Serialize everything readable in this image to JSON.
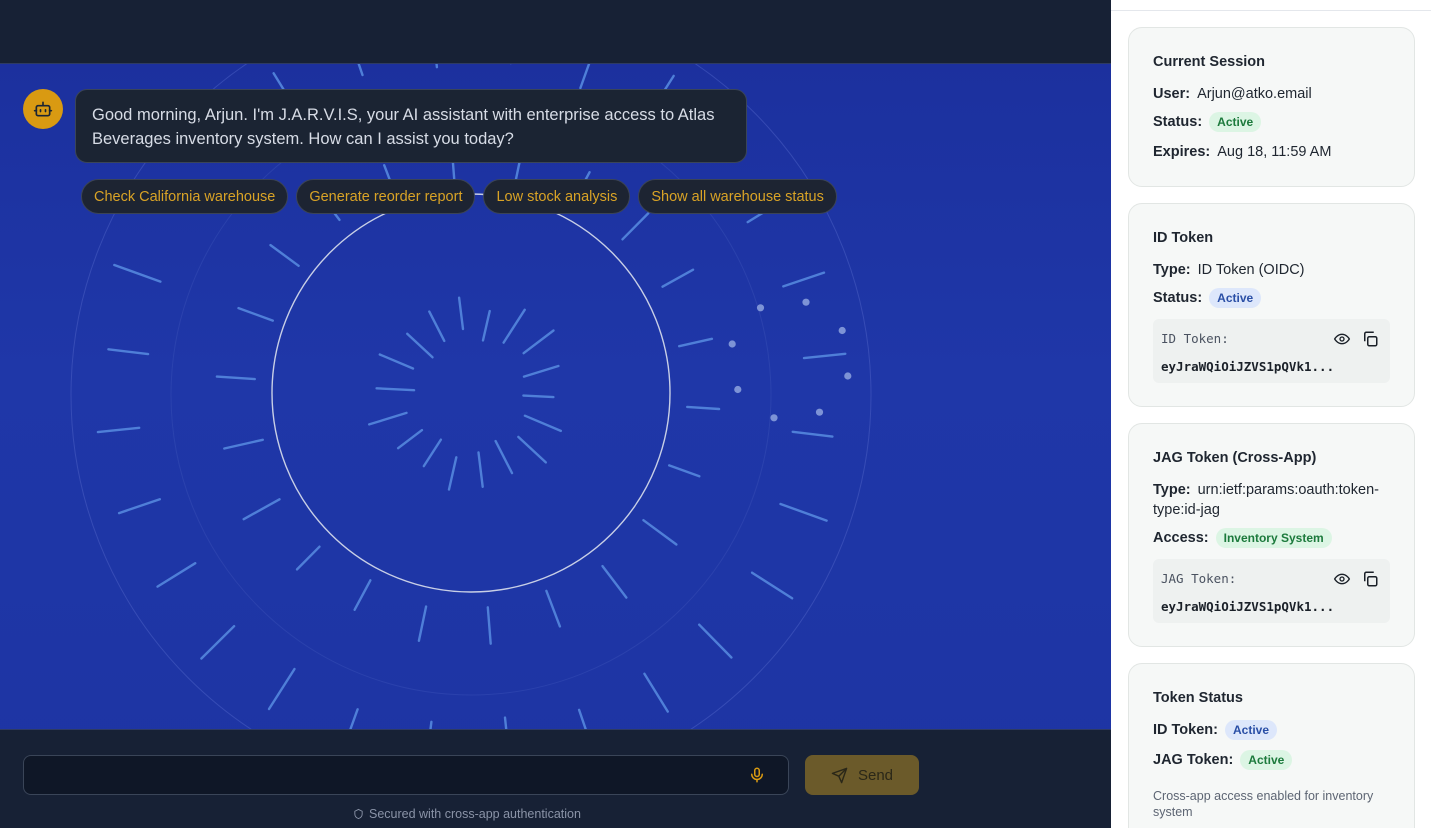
{
  "chat": {
    "assistant_message": "Good morning, Arjun. I'm J.A.R.V.I.S, your AI assistant with enterprise access to Atlas Beverages inventory system. How can I assist you today?",
    "suggestions": [
      "Check California warehouse",
      "Generate reorder report",
      "Low stock analysis",
      "Show all warehouse status"
    ],
    "input_value": "",
    "send_label": "Send",
    "security_note": "Secured with cross-app authentication"
  },
  "panel": {
    "session": {
      "title": "Current Session",
      "user_label": "User:",
      "user_value": "Arjun@atko.email",
      "status_label": "Status:",
      "status_value": "Active",
      "expires_label": "Expires:",
      "expires_value": "Aug 18, 11:59 AM"
    },
    "id_token": {
      "title": "ID Token",
      "type_label": "Type:",
      "type_value": "ID Token (OIDC)",
      "status_label": "Status:",
      "status_value": "Active",
      "box_label": "ID Token:",
      "box_value": "eyJraWQiOiJZVS1pQVk1..."
    },
    "jag_token": {
      "title": "JAG Token (Cross-App)",
      "type_label": "Type:",
      "type_value_line1": "urn:ietf:params:oauth:token-",
      "type_value_line2": "type:id-jag",
      "access_label": "Access:",
      "access_value": "Inventory System",
      "box_label": "JAG Token:",
      "box_value": "eyJraWQiOiJZVS1pQVk1..."
    },
    "token_status": {
      "title": "Token Status",
      "id_label": "ID Token:",
      "id_value": "Active",
      "jag_label": "JAG Token:",
      "jag_value": "Active",
      "note": "Cross-app access enabled for inventory system"
    }
  },
  "icons": {
    "avatar": "robot-icon",
    "mic": "microphone-icon",
    "send": "paper-plane-icon",
    "secure": "shield-icon",
    "reveal": "eye-icon",
    "copy": "copy-icon"
  },
  "colors": {
    "accent": "#d99a12",
    "background": "#1f37a8",
    "bar": "#172135"
  }
}
